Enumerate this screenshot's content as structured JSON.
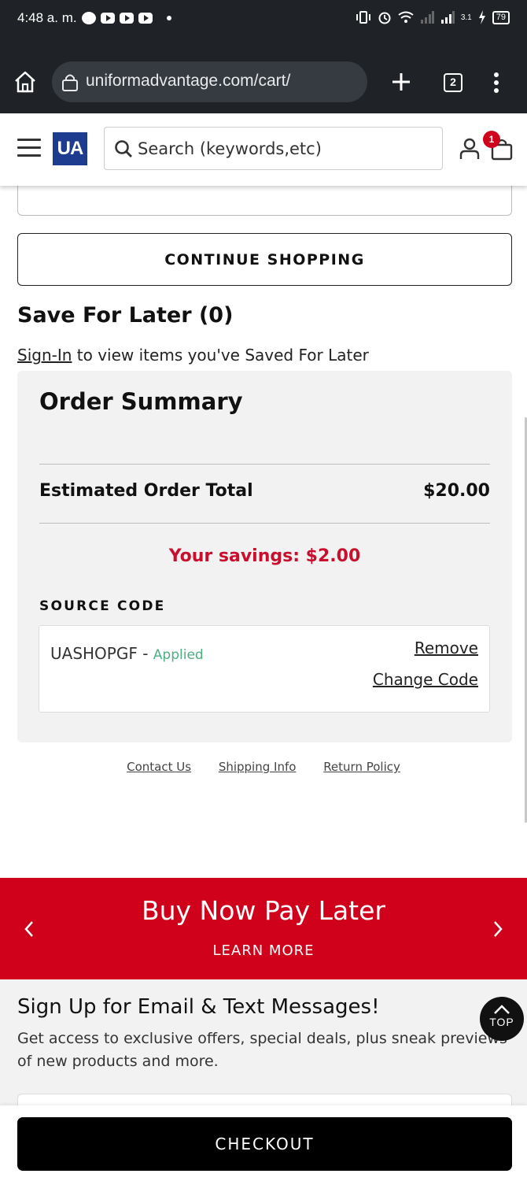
{
  "status_bar": {
    "time": "4:48 a. m.",
    "speed": "3.1",
    "battery": "79"
  },
  "browser": {
    "url": "uniformadvantage.com/cart/",
    "tab_count": "2"
  },
  "header": {
    "logo": "UA",
    "search_placeholder": "Search (keywords,etc)",
    "cart_count": "1"
  },
  "cart": {
    "continue_label": "CONTINUE SHOPPING",
    "save_for_later_title": "Save For Later (0)",
    "sign_in_link": "Sign-In",
    "save_for_later_text": " to view items you've Saved For Later"
  },
  "order_summary": {
    "title": "Order Summary",
    "total_label": "Estimated Order Total",
    "total_value": "$20.00",
    "savings": "Your savings: $2.00",
    "source_code_label": "SOURCE CODE",
    "code": "UASHOPGF - ",
    "code_status": "Applied",
    "remove_label": "Remove",
    "change_label": "Change Code"
  },
  "footer_links": [
    "Contact Us",
    "Shipping Info",
    "Return Policy"
  ],
  "promo": {
    "title": "Buy Now Pay Later",
    "link": "LEARN MORE"
  },
  "signup": {
    "title": "Sign Up for Email & Text Messages!",
    "text": "Get access to exclusive offers, special deals, plus sneak previews of new products and more."
  },
  "top_button": "TOP",
  "checkout_label": "CHECKOUT",
  "colors": {
    "brand_blue": "#1d3c8f",
    "accent_red": "#d0021b",
    "savings_red": "#c8102e",
    "applied_green": "#4caf80"
  }
}
